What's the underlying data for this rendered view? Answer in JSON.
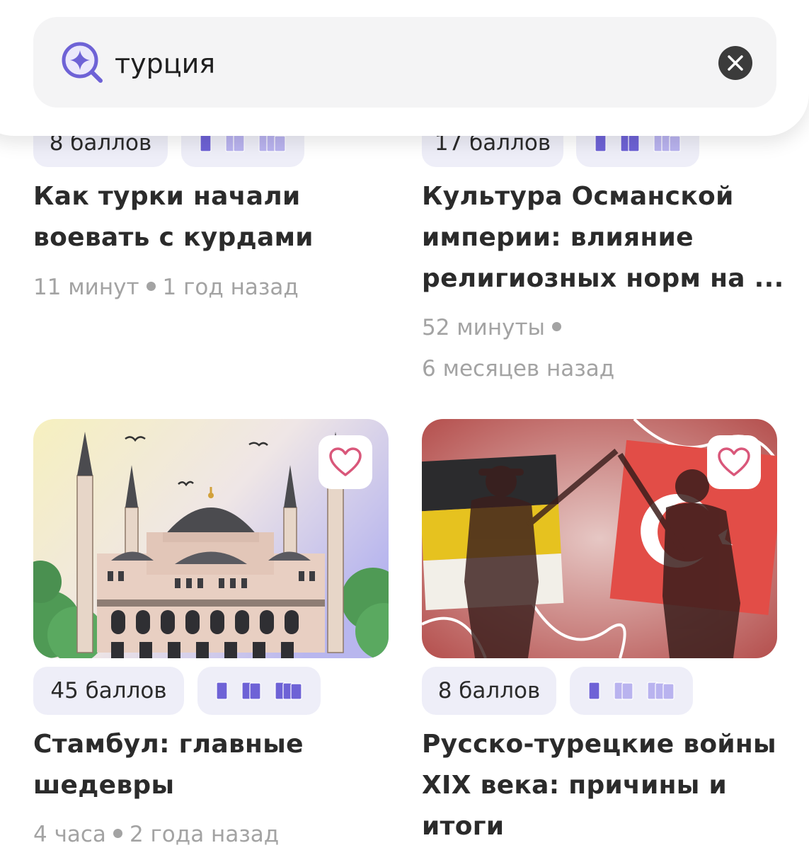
{
  "search": {
    "query": "турция",
    "placeholder": ""
  },
  "cards": [
    {
      "points": "8 баллов",
      "level": 1,
      "title_lines": [
        "Как турки начали",
        "воевать с курдами"
      ],
      "duration": "11 минут",
      "ago": "1 год назад"
    },
    {
      "points": "17 баллов",
      "level": 2,
      "title_lines": [
        "Культура Османской",
        "империи: влияние",
        "религиозных норм на ..."
      ],
      "duration": "52 минуты",
      "ago": "6 месяцев назад"
    },
    {
      "points": "45 баллов",
      "level": 3,
      "image": "hagia-sophia-illustration",
      "title_lines": [
        "Стамбул: главные",
        "шедевры"
      ],
      "duration": "4 часа",
      "ago": "2 года назад"
    },
    {
      "points": "8 баллов",
      "level": 1,
      "image": "russo-turkish-war-illustration",
      "title_lines": [
        "Русско-турецкие войны",
        "XIX века: причины и",
        "итоги"
      ],
      "duration": "",
      "ago": ""
    }
  ],
  "colors": {
    "accent": "#6e62d6",
    "book_active": "#6e62d6",
    "book_inactive": "#b9b3ef",
    "pill_bg": "#eeeef8",
    "meta_text": "#a3a3a3"
  },
  "icons": [
    "search-sparkle-icon",
    "clear-icon",
    "heart-icon",
    "book-level-icon"
  ]
}
